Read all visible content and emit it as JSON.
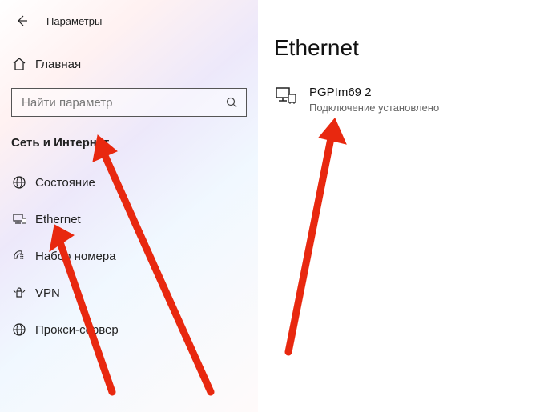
{
  "header": {
    "app_title": "Параметры",
    "home_label": "Главная"
  },
  "search": {
    "placeholder": "Найти параметр"
  },
  "sidebar": {
    "section_header": "Сеть и Интернет",
    "items": [
      {
        "label": "Состояние"
      },
      {
        "label": "Ethernet"
      },
      {
        "label": "Набор номера"
      },
      {
        "label": "VPN"
      },
      {
        "label": "Прокси-сервер"
      }
    ]
  },
  "main": {
    "heading": "Ethernet",
    "connection": {
      "name": "PGPIm69 2",
      "status": "Подключение установлено"
    }
  },
  "annotation_color": "#e8280f"
}
